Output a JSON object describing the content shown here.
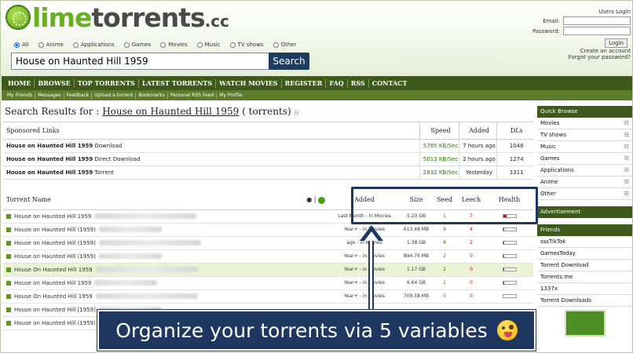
{
  "logo": {
    "part1": "lime",
    "part2": "torrents",
    "part3": ".cc"
  },
  "categories": [
    {
      "label": "All",
      "selected": true
    },
    {
      "label": "Anime",
      "selected": false
    },
    {
      "label": "Applications",
      "selected": false
    },
    {
      "label": "Games",
      "selected": false
    },
    {
      "label": "Movies",
      "selected": false
    },
    {
      "label": "Music",
      "selected": false
    },
    {
      "label": "TV shows",
      "selected": false
    },
    {
      "label": "Other",
      "selected": false
    }
  ],
  "search": {
    "value": "House on Haunted Hill  1959",
    "button": "Search"
  },
  "login": {
    "title": "Users Login",
    "email_label": "Email:",
    "password_label": "Password:",
    "button": "Login",
    "create": "Create an account",
    "forgot": "Forgot your password?"
  },
  "nav": [
    "HOME",
    "BROWSE",
    "TOP TORRENTS",
    "LATEST TORRENTS",
    "WATCH MOVIES",
    "REGISTER",
    "FAQ",
    "RSS",
    "CONTACT"
  ],
  "subnav": [
    "My Friends",
    "Messages",
    "Feedback",
    "Upload a torrent",
    "Bookmarks",
    "Personal RSS Feed",
    "My Profile"
  ],
  "results_title": {
    "prefix": "Search Results for : ",
    "query": "House on Haunted Hill 1959",
    "suffix": " ( torrents)"
  },
  "sponsored": {
    "headers": [
      "Sponsored Links",
      "Speed",
      "Added",
      "DLs"
    ],
    "rows": [
      {
        "name": "House on Haunted Hill 1959",
        "type": "Download",
        "speed": "5785 KB/Sec",
        "added": "7 hours ago",
        "dls": "1046"
      },
      {
        "name": "House on Haunted Hill 1959",
        "type": "Direct Download",
        "speed": "5013 KB/Sec",
        "added": "2 hours ago",
        "dls": "1274"
      },
      {
        "name": "House on Haunted Hill 1959",
        "type": "Torrent",
        "speed": "2832 KB/Sec",
        "added": "Yesterday",
        "dls": "1311"
      }
    ]
  },
  "results": {
    "headers": [
      "Torrent Name",
      "Added",
      "Size",
      "Seed",
      "Leech",
      "Health"
    ],
    "rows": [
      {
        "name": "House on Haunted Hill 1959",
        "added": "Last Month - in Movies",
        "size": "5.23 GB",
        "seed": "1",
        "leech": "7",
        "health": 0.3,
        "highlight": false
      },
      {
        "name": "House on Haunted Hill (1959)",
        "added": "Year+ - in Movies",
        "size": "613.48 MB",
        "seed": "9",
        "leech": "4",
        "health": 0.1,
        "highlight": false
      },
      {
        "name": "House on Haunted Hill (1959)",
        "added": "ago - in Movies",
        "size": "1.38 GB",
        "seed": "8",
        "leech": "2",
        "health": 0.1,
        "highlight": false
      },
      {
        "name": "House on Haunted Hill (1959)",
        "added": "Year+ - in Movies",
        "size": "894.76 MB",
        "seed": "2",
        "leech": "0",
        "health": 0.1,
        "highlight": false
      },
      {
        "name": "House On Haunted Hill 1959",
        "added": "Year+ - in Movies",
        "size": "1.17 GB",
        "seed": "2",
        "leech": "0",
        "health": 0.1,
        "highlight": true
      },
      {
        "name": "House on Haunted Hill 1959",
        "added": "Year+ - in Movies",
        "size": "6.64 GB",
        "seed": "1",
        "leech": "0",
        "health": 0.1,
        "highlight": false
      },
      {
        "name": "House On Haunted Hill 1959",
        "added": "Year+ - in Movies",
        "size": "709.58 MB",
        "seed": "0",
        "leech": "0",
        "health": 0.0,
        "highlight": false
      },
      {
        "name": "House on Haunted Hill [1959]",
        "added": "",
        "size": "",
        "seed": "",
        "leech": "",
        "health": 0.0,
        "highlight": false
      },
      {
        "name": "House on Haunted Hill (1959)",
        "added": "",
        "size": "",
        "seed": "",
        "leech": "",
        "health": 0.0,
        "highlight": false
      }
    ]
  },
  "sidebar": {
    "quick_browse": "Quick Browse",
    "categories": [
      "Movies",
      "TV shows",
      "Music",
      "Games",
      "Applications",
      "Anime",
      "Other"
    ],
    "advertisement": "Advertisement",
    "friends": "Friends",
    "friend_links": [
      "sssTikTok",
      "GamesToday",
      "Torrent Download",
      "Torrents.me",
      "1337x",
      "Torrent Downloads"
    ]
  },
  "banner": {
    "text": "Organize your torrents via 5 variables"
  },
  "colors": {
    "nav": "#3d5a1a",
    "accent": "#67b021",
    "banner": "#1d3760",
    "seed": "#2d7a00",
    "leech": "#c01010"
  }
}
